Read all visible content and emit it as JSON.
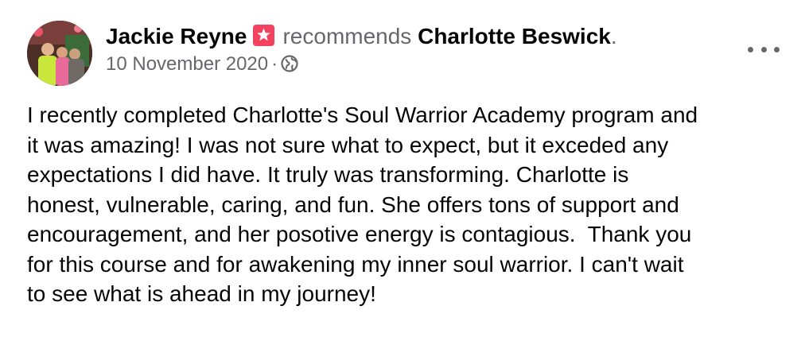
{
  "post": {
    "author": "Jackie Reyne",
    "action": "recommends",
    "target": "Charlotte Beswick",
    "period": ".",
    "date": "10 November 2020",
    "separator": "·",
    "recommend_icon": "star-flag-icon",
    "audience_icon": "globe-icon",
    "more_icon": "more-options-icon",
    "body_lines": [
      "I recently completed Charlotte's Soul Warrior Academy program and",
      "it was amazing! I was not sure what to expect, but it exceded any",
      "expectations I did have. It truly was transforming. Charlotte is",
      "honest, vulnerable, caring, and fun. She offers tons of support and",
      "encouragement, and her posotive energy is contagious.  Thank you",
      "for this course and for awakening my inner soul warrior. I can't wait",
      "to see what is ahead in my journey!"
    ]
  },
  "colors": {
    "primary_text": "#050505",
    "secondary_text": "#65676b",
    "recommend_pink": "#f3425f"
  }
}
